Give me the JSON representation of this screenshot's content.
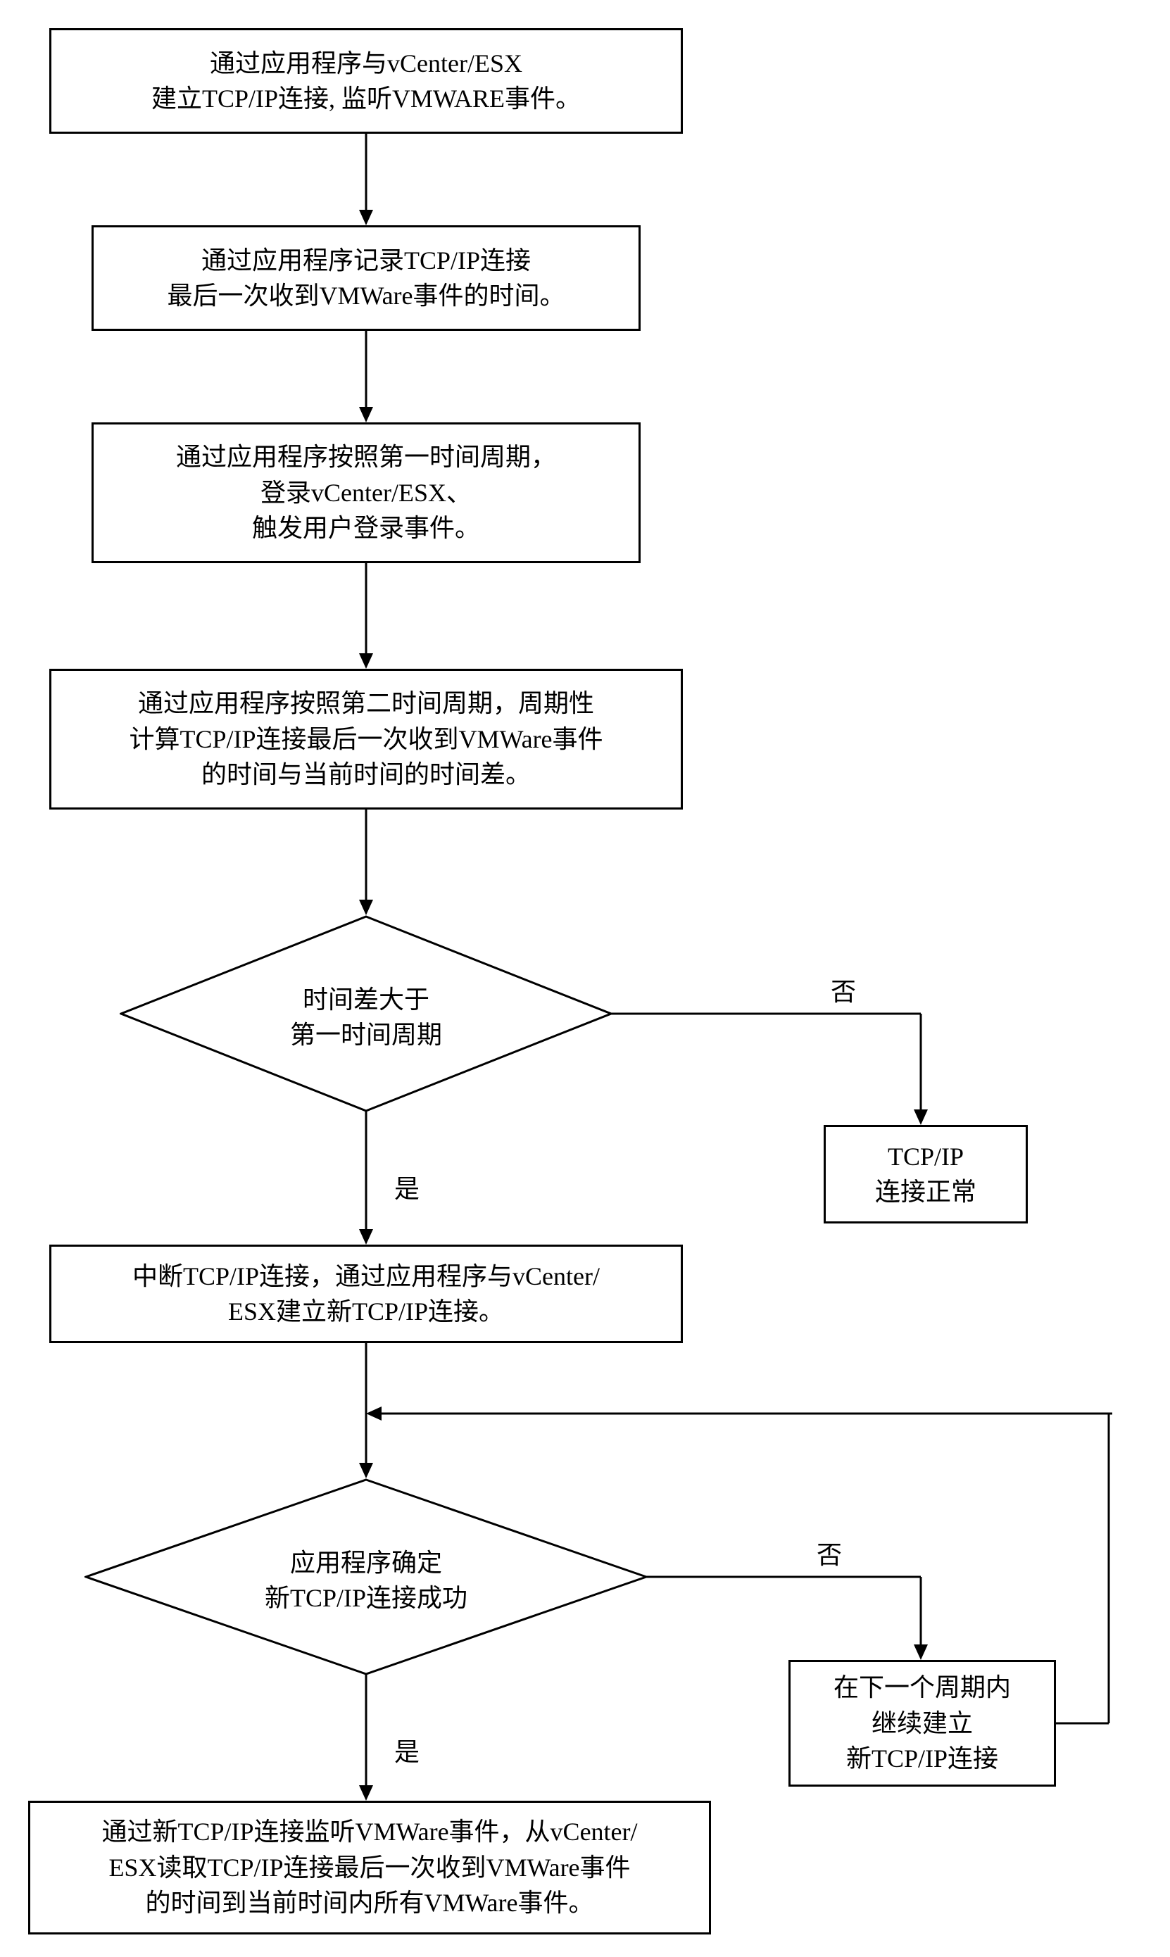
{
  "flowchart": {
    "type": "flowchart",
    "nodes": {
      "step1": "通过应用程序与vCenter/ESX\n建立TCP/IP连接, 监听VMWARE事件。",
      "step2": "通过应用程序记录TCP/IP连接\n最后一次收到VMWare事件的时间。",
      "step3": "通过应用程序按照第一时间周期，\n登录vCenter/ESX、\n触发用户登录事件。",
      "step4": "通过应用程序按照第二时间周期，周期性\n计算TCP/IP连接最后一次收到VMWare事件\n的时间与当前时间的时间差。",
      "decision1": "时间差大于\n第一时间周期",
      "tcpok": "TCP/IP\n连接正常",
      "step5": "中断TCP/IP连接，通过应用程序与vCenter/\nESX建立新TCP/IP连接。",
      "decision2": "应用程序确定\n新TCP/IP连接成功",
      "retry": "在下一个周期内\n继续建立\n新TCP/IP连接",
      "step6": "通过新TCP/IP连接监听VMWare事件，从vCenter/\nESX读取TCP/IP连接最后一次收到VMWare事件\n的时间到当前时间内所有VMWare事件。"
    },
    "edge_labels": {
      "yes1": "是",
      "no1": "否",
      "yes2": "是",
      "no2": "否"
    },
    "edges": [
      {
        "from": "step1",
        "to": "step2"
      },
      {
        "from": "step2",
        "to": "step3"
      },
      {
        "from": "step3",
        "to": "step4"
      },
      {
        "from": "step4",
        "to": "decision1"
      },
      {
        "from": "decision1",
        "to": "step5",
        "label": "是"
      },
      {
        "from": "decision1",
        "to": "tcpok",
        "label": "否"
      },
      {
        "from": "step5",
        "to": "decision2"
      },
      {
        "from": "decision2",
        "to": "step6",
        "label": "是"
      },
      {
        "from": "decision2",
        "to": "retry",
        "label": "否"
      },
      {
        "from": "retry",
        "to": "decision2_in",
        "note": "loops back above decision2"
      }
    ]
  }
}
